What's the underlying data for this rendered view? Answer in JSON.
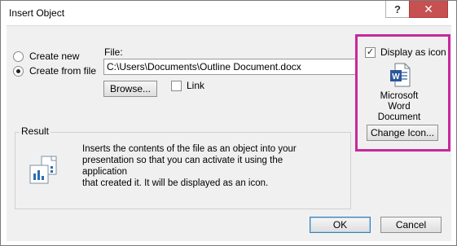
{
  "window": {
    "title": "Insert Object",
    "help_label": "?",
    "close_label": "✕"
  },
  "options": {
    "create_new": "Create new",
    "create_from_file": "Create from file",
    "selected": "create_from_file"
  },
  "file": {
    "label": "File:",
    "value": "C:\\Users\\Documents\\Outline Document.docx",
    "browse_label": "Browse...",
    "link_label": "Link",
    "link_checked": false
  },
  "display_as_icon": {
    "label": "Display as icon",
    "checked": true,
    "icon_name": "word-document-icon",
    "caption_line1": "Microsoft",
    "caption_line2": "Word",
    "caption_line3": "Document",
    "change_icon_label": "Change Icon..."
  },
  "result": {
    "legend": "Result",
    "line1": "Inserts the contents of the file as an object into your",
    "line2": "presentation so that you can activate it using the application",
    "line3": "that created it. It will be displayed as an icon.",
    "icon_name": "object-icon"
  },
  "buttons": {
    "ok": "OK",
    "cancel": "Cancel"
  },
  "colors": {
    "highlight": "#c8289c",
    "close_button": "#c75050",
    "word_blue": "#2b579a"
  }
}
